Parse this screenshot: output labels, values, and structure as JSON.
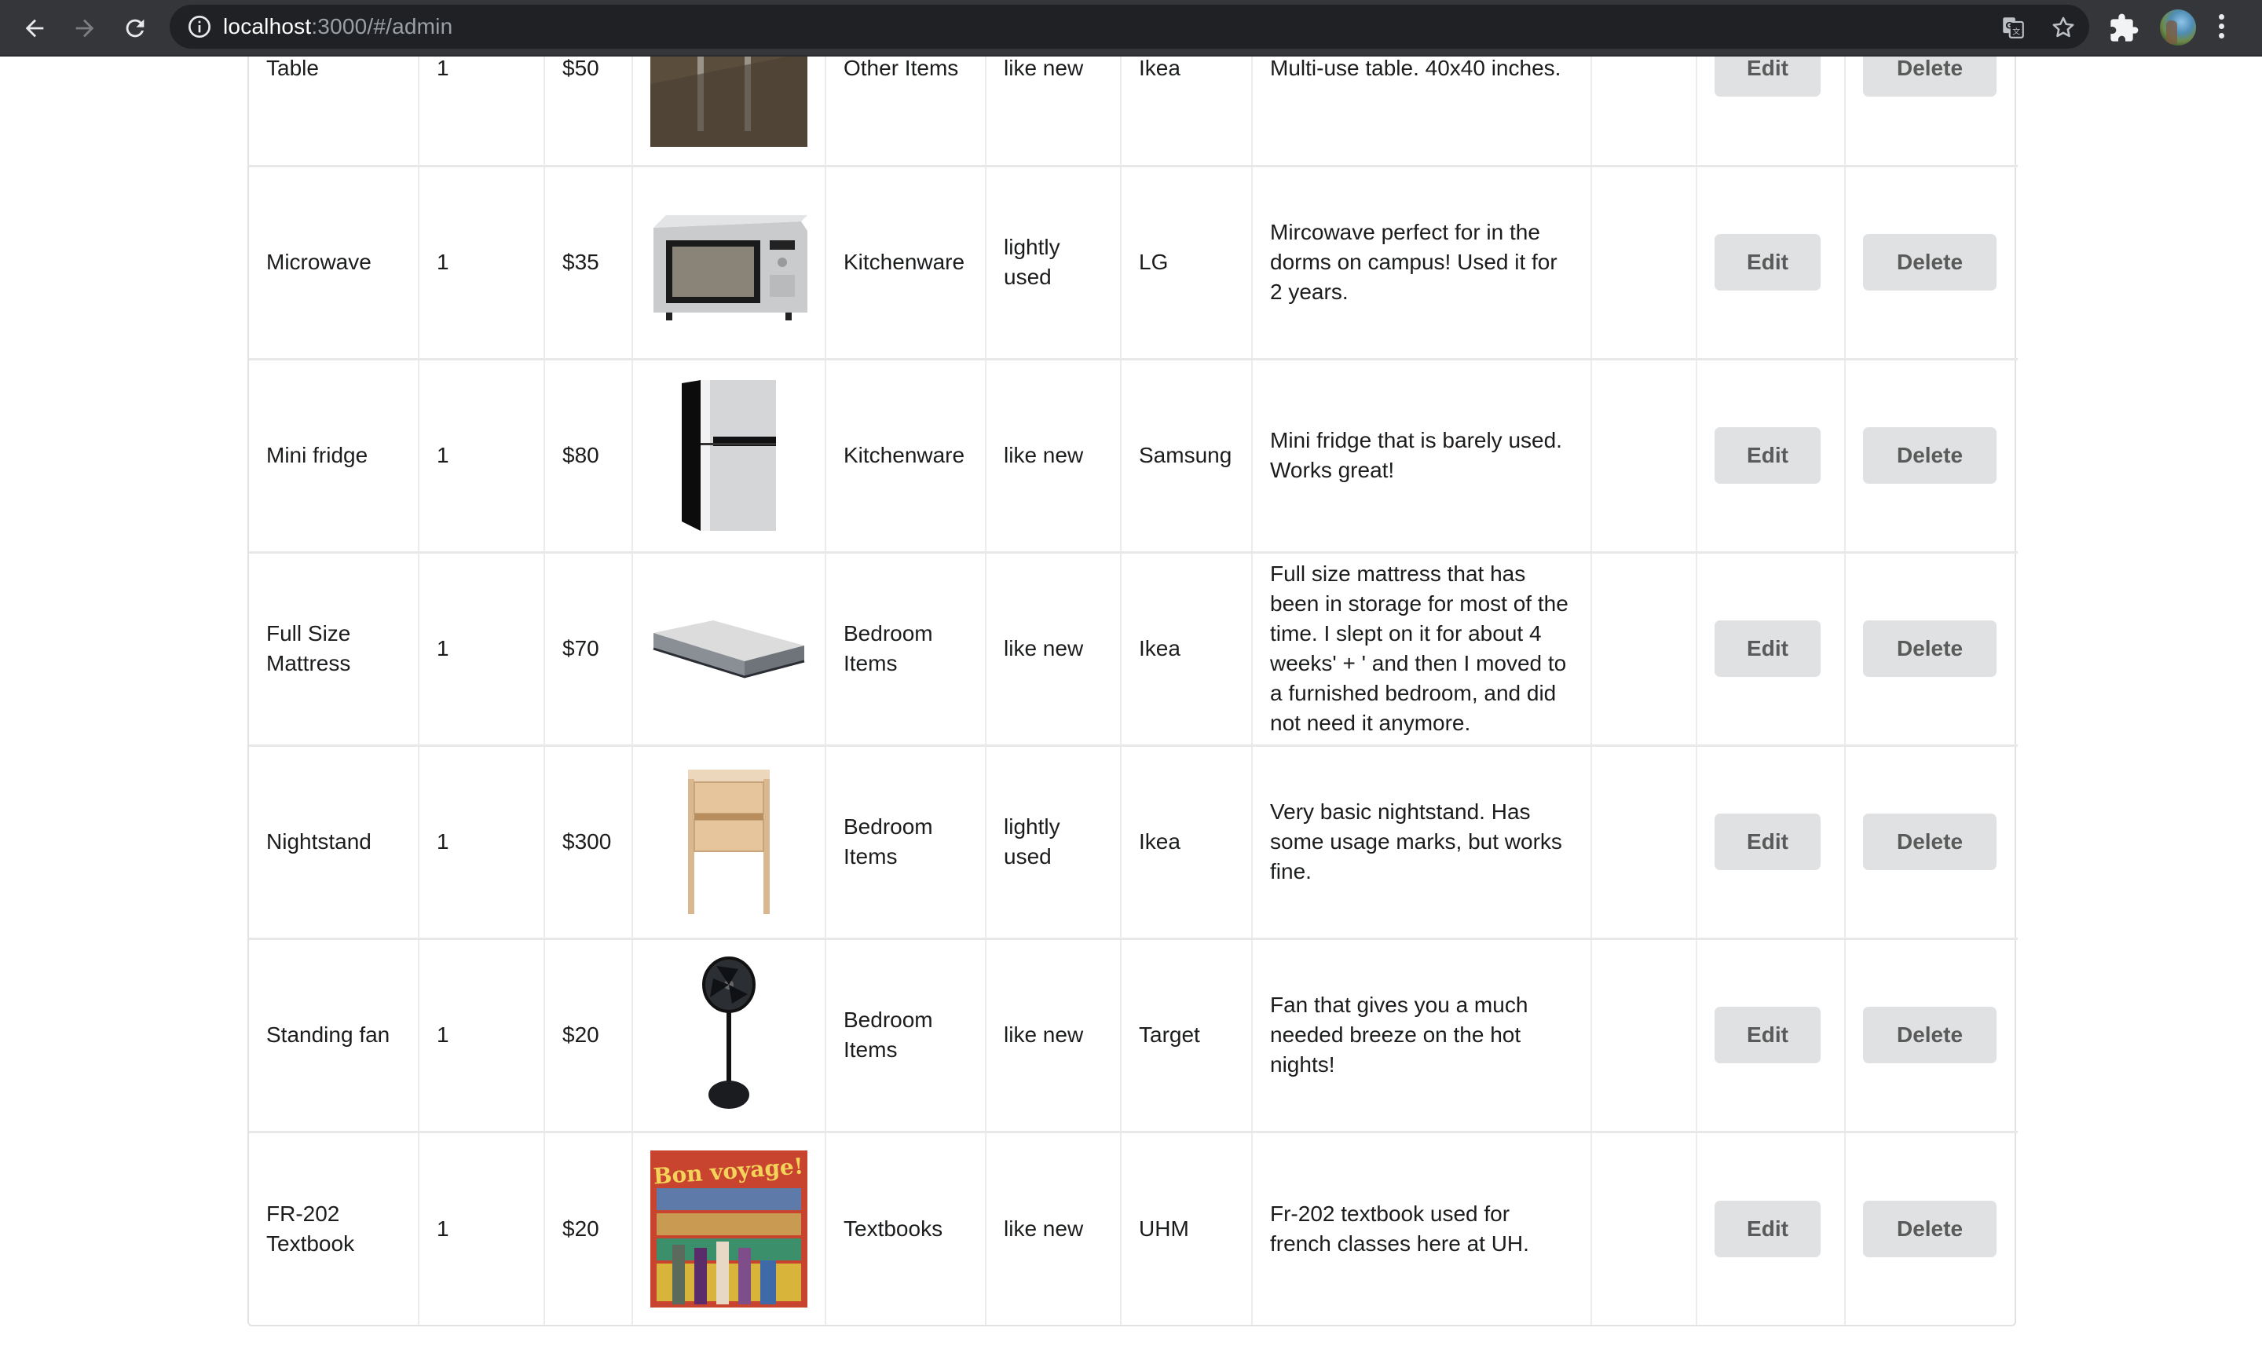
{
  "browser": {
    "url_host": "localhost",
    "url_rest": ":3000/#/admin",
    "icons": {
      "back": "arrow-left-icon",
      "forward": "arrow-right-icon",
      "reload": "reload-icon",
      "site_info": "info-icon",
      "translate": "translate-icon",
      "bookmark": "star-icon",
      "extensions": "puzzle-icon",
      "profile": "avatar",
      "menu": "more-vert-icon"
    }
  },
  "table": {
    "rows": [
      {
        "name": "Table",
        "quantity": "1",
        "price": "$50",
        "image": "table-photo",
        "category": "Other Items",
        "condition": "like new",
        "owner": "Ikea",
        "description": "Multi-use table. 40x40 inches.",
        "edit_label": "Edit",
        "delete_label": "Delete"
      },
      {
        "name": "Microwave",
        "quantity": "1",
        "price": "$35",
        "image": "microwave-photo",
        "category": "Kitchenware",
        "condition": "lightly used",
        "owner": "LG",
        "description": "Mircowave perfect for in the dorms on campus! Used it for 2 years.",
        "edit_label": "Edit",
        "delete_label": "Delete"
      },
      {
        "name": "Mini fridge",
        "quantity": "1",
        "price": "$80",
        "image": "mini-fridge-photo",
        "category": "Kitchenware",
        "condition": "like new",
        "owner": "Samsung",
        "description": "Mini fridge that is barely used. Works great!",
        "edit_label": "Edit",
        "delete_label": "Delete"
      },
      {
        "name": "Full Size Mattress",
        "quantity": "1",
        "price": "$70",
        "image": "mattress-photo",
        "category": "Bedroom Items",
        "condition": "like new",
        "owner": "Ikea",
        "description": "Full size mattress that has been in storage for most of the time. I slept on it for about 4 weeks' + ' and then I moved to a furnished bedroom, and did not need it anymore.",
        "edit_label": "Edit",
        "delete_label": "Delete"
      },
      {
        "name": "Nightstand",
        "quantity": "1",
        "price": "$300",
        "image": "nightstand-photo",
        "category": "Bedroom Items",
        "condition": "lightly used",
        "owner": "Ikea",
        "description": "Very basic nightstand. Has some usage marks, but works fine.",
        "edit_label": "Edit",
        "delete_label": "Delete"
      },
      {
        "name": "Standing fan",
        "quantity": "1",
        "price": "$20",
        "image": "standing-fan-photo",
        "category": "Bedroom Items",
        "condition": "like new",
        "owner": "Target",
        "description": "Fan that gives you a much needed breeze on the hot nights!",
        "edit_label": "Edit",
        "delete_label": "Delete"
      },
      {
        "name": "FR-202 Textbook",
        "quantity": "1",
        "price": "$20",
        "image": "textbook-cover-photo",
        "image_text": "Bon voyage!",
        "category": "Textbooks",
        "condition": "like new",
        "owner": "UHM",
        "description": "Fr-202 textbook used for french classes here at UH.",
        "edit_label": "Edit",
        "delete_label": "Delete"
      }
    ]
  },
  "colors": {
    "toolbar_bg": "#35363a",
    "omnibox_bg": "#202124",
    "button_bg": "#e0e1e2",
    "button_text": "#5a5a5a",
    "cell_border": "#ececec",
    "text": "#1b1c1d"
  }
}
